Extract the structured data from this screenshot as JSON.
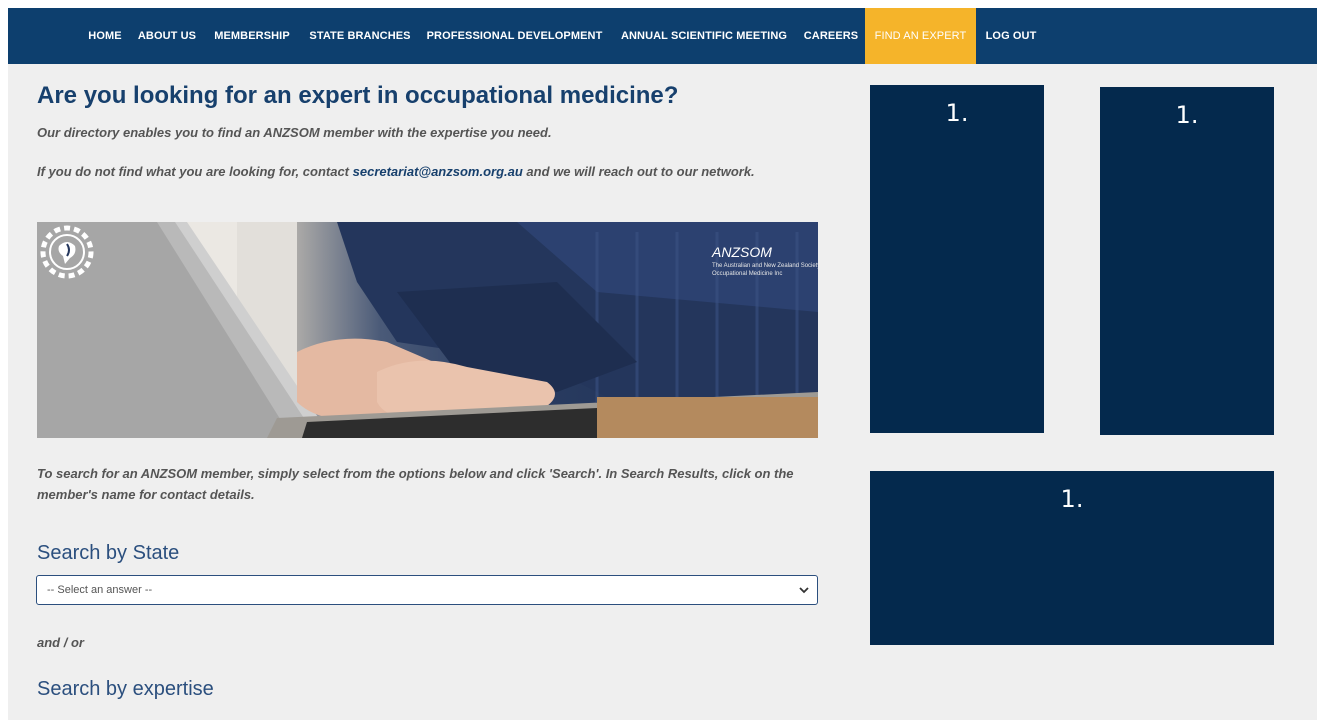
{
  "nav": {
    "items": [
      {
        "label": "HOME"
      },
      {
        "label": "ABOUT US"
      },
      {
        "label": "MEMBERSHIP"
      },
      {
        "label": "STATE BRANCHES"
      },
      {
        "label": "PROFESSIONAL DEVELOPMENT"
      },
      {
        "label": "ANNUAL SCIENTIFIC MEETING"
      },
      {
        "label": "CAREERS"
      },
      {
        "label": "FIND AN EXPERT",
        "active": true
      },
      {
        "label": "LOG OUT"
      }
    ]
  },
  "main": {
    "title": "Are you looking for an expert in occupational medicine?",
    "intro": "Our directory enables you to find an ANZSOM member with the expertise you need.",
    "contact_prefix": "If you do not find what you are looking for, contact ",
    "contact_email": "secretariat@anzsom.org.au",
    "contact_suffix": " and we will reach out to our network.",
    "hero_logo_name": "ANZSOM",
    "hero_logo_sub": "The Australian and New Zealand Society of Occupational Medicine Inc",
    "instructions": "To search for an ANZSOM member, simply select from the options below and click 'Search'. In Search Results, click on the member's name for contact details.",
    "search_state_heading": "Search by State",
    "state_select_value": "-- Select an answer --",
    "and_or": "and / or",
    "search_expertise_heading": "Search by expertise"
  },
  "ads": [
    {
      "label": "1."
    },
    {
      "label": "1."
    },
    {
      "label": "1."
    }
  ],
  "colors": {
    "nav_bg": "#0d3f6e",
    "nav_active": "#f5b42a",
    "heading": "#17406d",
    "ad_bg": "#04294d",
    "page_bg": "#efefef"
  }
}
